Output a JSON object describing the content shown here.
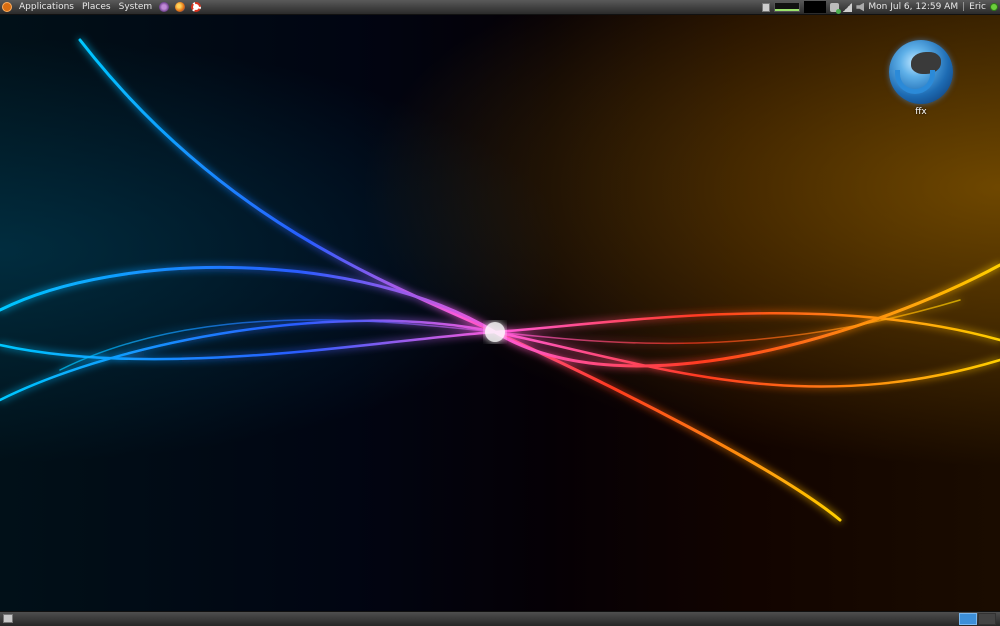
{
  "top_panel": {
    "menus": [
      "Applications",
      "Places",
      "System"
    ],
    "clock": "Mon Jul  6, 12:59 AM",
    "separator": "|",
    "user": "Eric"
  },
  "desktop": {
    "icons": [
      {
        "label": "ffx",
        "icon": "firefox-icon"
      }
    ]
  },
  "bottom_panel": {
    "workspaces": 2,
    "active_workspace": 1
  },
  "colors": {
    "panel": "#3a3a3a",
    "wallpaper_left": "#00a8ff",
    "wallpaper_right": "#ffb000",
    "workspace_active": "#3d8fd8"
  }
}
